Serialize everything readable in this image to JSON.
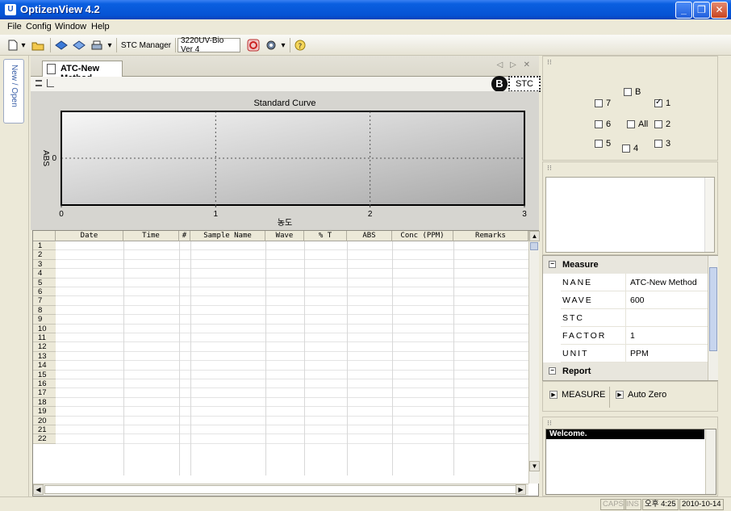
{
  "window": {
    "title": "OptizenView 4.2",
    "app_icon": "U",
    "min": "_",
    "max": "❐",
    "close": "✕"
  },
  "menu": {
    "items": [
      {
        "label": "File",
        "key": "F"
      },
      {
        "label": "Config",
        "key": "C"
      },
      {
        "label": "Window",
        "key": "W"
      },
      {
        "label": "Help",
        "key": "H"
      }
    ]
  },
  "toolbar": {
    "stc_manager": "STC Manager",
    "instrument": "3220UV-Bio Ver 4"
  },
  "left_dock": {
    "tab_label": "New / Open"
  },
  "document": {
    "tab_title": "ATC-New Method",
    "tab_controls": "◁ ▷ ✕",
    "badge": "B",
    "stc_label": "STC"
  },
  "chart_data": {
    "type": "line",
    "title": "Standard Curve",
    "xlabel": "농도",
    "ylabel": "ABS",
    "xlim": [
      0,
      3
    ],
    "x_ticks": [
      "0",
      "1",
      "2",
      "3"
    ],
    "y_ticks": [
      "0"
    ],
    "series": [],
    "grid": true
  },
  "grid": {
    "columns": [
      "Date",
      "Time",
      "#",
      "Sample Name",
      "Wave",
      "% T",
      "ABS",
      "Conc (PPM)",
      "Remarks"
    ],
    "rows": [
      "1",
      "2",
      "3",
      "4",
      "5",
      "6",
      "7",
      "8",
      "9",
      "10",
      "11",
      "12",
      "13",
      "14",
      "15",
      "16",
      "17",
      "18",
      "19",
      "20",
      "21",
      "22"
    ]
  },
  "checkboxes": [
    {
      "label": "7",
      "checked": false
    },
    {
      "label": "B",
      "checked": false
    },
    {
      "label": "1",
      "checked": true
    },
    {
      "label": "6",
      "checked": false
    },
    {
      "label": "All",
      "checked": false
    },
    {
      "label": "2",
      "checked": false
    },
    {
      "label": "5",
      "checked": false
    },
    {
      "label": "4",
      "checked": false
    },
    {
      "label": "3",
      "checked": false
    }
  ],
  "properties": {
    "measure_section": "Measure",
    "report_section": "Report",
    "rows": [
      {
        "key": "NANE",
        "value": "ATC-New Method"
      },
      {
        "key": "WAVE",
        "value": "600"
      },
      {
        "key": "STC",
        "value": ""
      },
      {
        "key": "FACTOR",
        "value": "1"
      },
      {
        "key": "UNIT",
        "value": "PPM"
      }
    ]
  },
  "actions": {
    "measure": "MEASURE",
    "auto_zero": "Auto Zero"
  },
  "log": {
    "line": "Welcome."
  },
  "status": {
    "caps": "CAPS",
    "ins": "INS",
    "time": "오후 4:25",
    "date": "2010-10-14"
  },
  "colors": {
    "title_bar": "#0653d4",
    "chart_bg": "#d6d5d0",
    "log_bg": "#000000"
  }
}
